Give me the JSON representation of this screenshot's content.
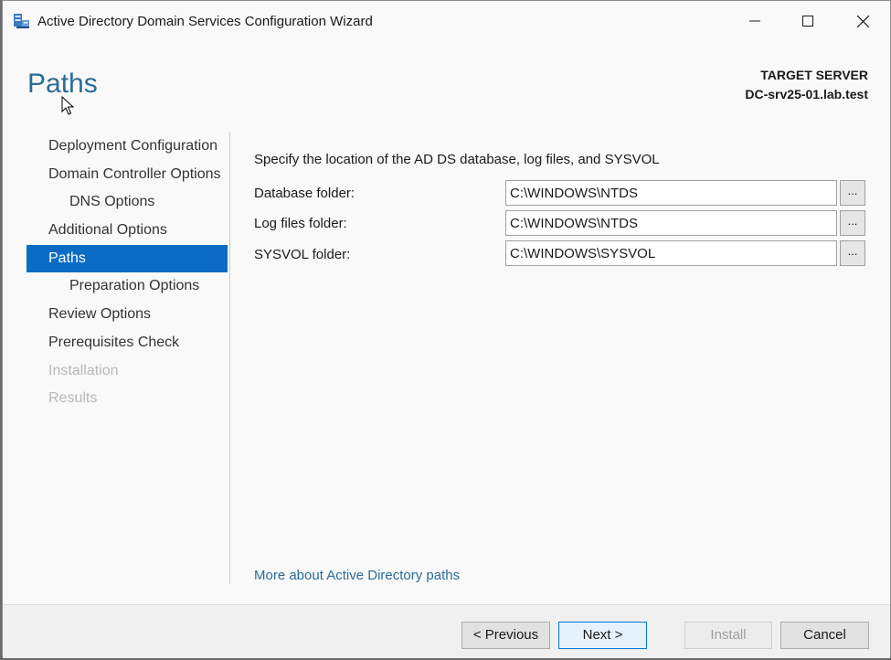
{
  "window": {
    "title": "Active Directory Domain Services Configuration Wizard",
    "icon": "ad-ds-server-icon",
    "controls": [
      "minimize-icon",
      "maximize-icon",
      "close-icon"
    ]
  },
  "header": {
    "page_title": "Paths",
    "target_label": "TARGET SERVER",
    "target_name": "DC-srv25-01.lab.test"
  },
  "sidebar": {
    "items": [
      {
        "label": "Deployment Configuration",
        "state": "normal"
      },
      {
        "label": "Domain Controller Options",
        "state": "normal"
      },
      {
        "label": "DNS Options",
        "state": "normal",
        "sub": true
      },
      {
        "label": "Additional Options",
        "state": "normal"
      },
      {
        "label": "Paths",
        "state": "active"
      },
      {
        "label": "Preparation Options",
        "state": "normal",
        "sub": true
      },
      {
        "label": "Review Options",
        "state": "normal"
      },
      {
        "label": "Prerequisites Check",
        "state": "normal"
      },
      {
        "label": "Installation",
        "state": "disabled"
      },
      {
        "label": "Results",
        "state": "disabled"
      }
    ]
  },
  "main": {
    "intro": "Specify the location of the AD DS database, log files, and SYSVOL",
    "fields": [
      {
        "label": "Database folder:",
        "value": "C:\\WINDOWS\\NTDS",
        "browse": "..."
      },
      {
        "label": "Log files folder:",
        "value": "C:\\WINDOWS\\NTDS",
        "browse": "..."
      },
      {
        "label": "SYSVOL folder:",
        "value": "C:\\WINDOWS\\SYSVOL",
        "browse": "..."
      }
    ],
    "more_link": "More about Active Directory paths"
  },
  "footer": {
    "previous": "< Previous",
    "next": "Next >",
    "install": "Install",
    "cancel": "Cancel"
  },
  "colors": {
    "accent": "#0a6cc4",
    "title_blue": "#2b6c97",
    "disabled_text": "#b8b8b8"
  }
}
